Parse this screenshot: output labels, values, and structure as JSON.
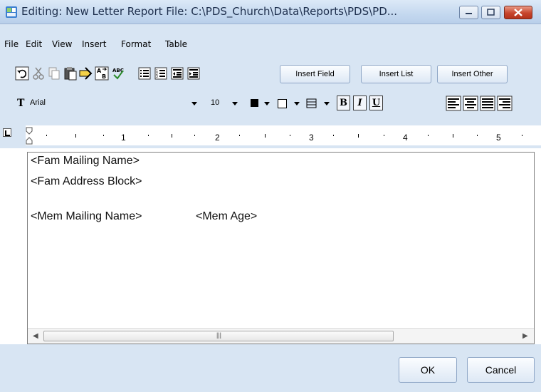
{
  "window": {
    "title": "Editing: New Letter Report   File: C:\\PDS_Church\\Data\\Reports\\PDS\\PD..."
  },
  "menu": [
    "File",
    "Edit",
    "View",
    "Insert",
    "Format",
    "Table"
  ],
  "toolbar": {
    "insert_field": "Insert Field",
    "insert_list": "Insert List",
    "insert_other": "Insert Other",
    "font_name": "Arial",
    "font_size": "10",
    "bold": "B",
    "italic": "I",
    "underline": "U"
  },
  "ruler": {
    "numbers": [
      "1",
      "2",
      "3",
      "4",
      "5"
    ]
  },
  "document": {
    "lines": [
      "<Fam Mailing Name>",
      "<Fam Address Block>",
      "<Mem Mailing Name>",
      "<Mem Age>"
    ]
  },
  "buttons": {
    "ok": "OK",
    "cancel": "Cancel"
  }
}
